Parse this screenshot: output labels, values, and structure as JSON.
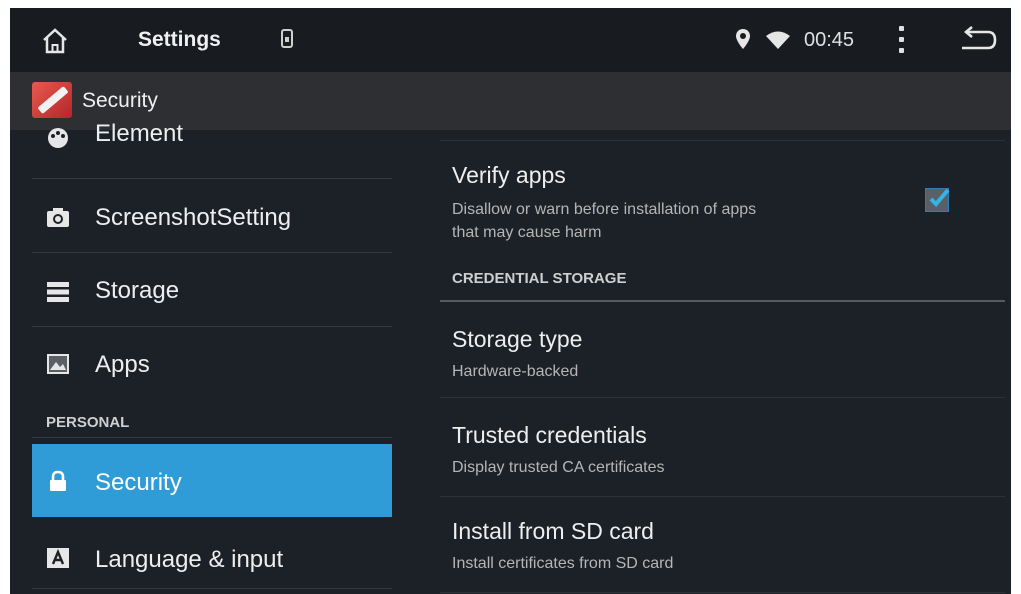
{
  "status_bar": {
    "title": "Settings",
    "time": "00:45",
    "icons": [
      "home-icon",
      "sim-icon",
      "location-icon",
      "wifi-icon",
      "overflow-menu-icon",
      "back-icon"
    ]
  },
  "action_bar": {
    "title": "Security",
    "icon": "settings-wrench-icon"
  },
  "left_panel": {
    "items": [
      {
        "label": "Element",
        "icon": "element-icon"
      },
      {
        "label": "ScreenshotSetting",
        "icon": "camera-icon"
      },
      {
        "label": "Storage",
        "icon": "storage-icon"
      },
      {
        "label": "Apps",
        "icon": "apps-icon"
      }
    ],
    "section_header": "PERSONAL",
    "personal_items": [
      {
        "label": "Security",
        "icon": "lock-icon",
        "selected": true
      },
      {
        "label": "Language & input",
        "icon": "language-icon"
      }
    ]
  },
  "right_panel": {
    "verify_apps": {
      "title": "Verify apps",
      "summary_line1": "Disallow or warn before installation of apps",
      "summary_line2": "that may cause harm",
      "checked": true
    },
    "credential_header": "CREDENTIAL STORAGE",
    "items": [
      {
        "title": "Storage type",
        "summary": "Hardware-backed"
      },
      {
        "title": "Trusted credentials",
        "summary": "Display trusted CA certificates"
      },
      {
        "title": "Install from SD card",
        "summary": "Install certificates from SD card"
      }
    ]
  },
  "colors": {
    "accent": "#2f9bd7",
    "background": "#1c2128",
    "status_bar": "#181b20",
    "action_bar": "#2d2f32"
  }
}
